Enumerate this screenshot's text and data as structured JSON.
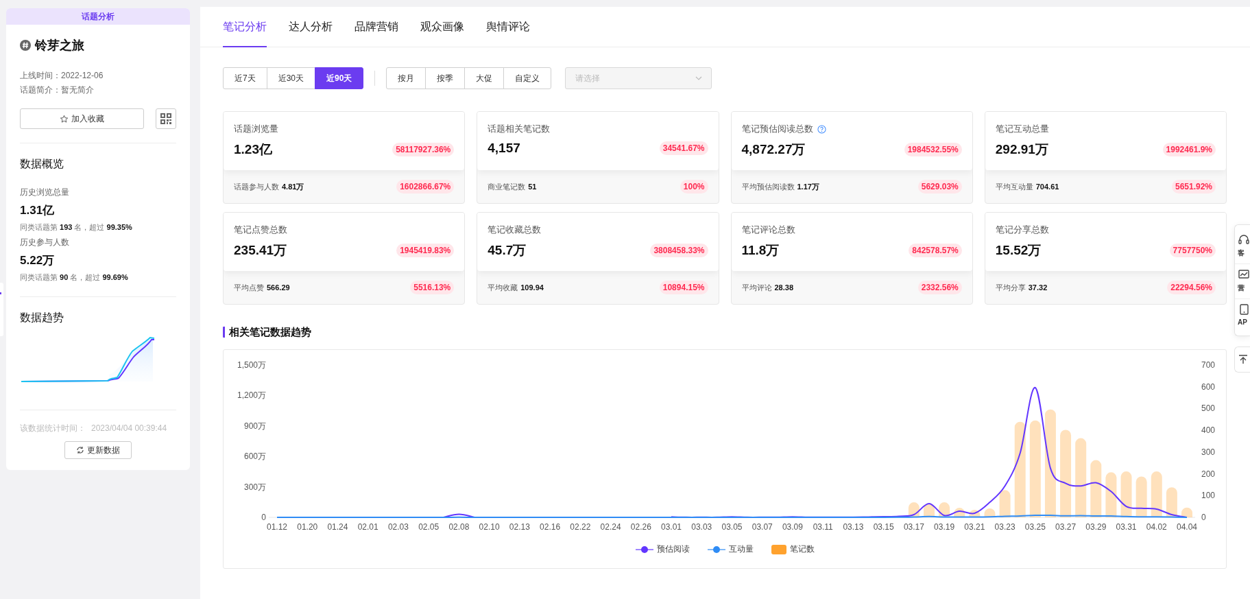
{
  "sidebar": {
    "header": "话题分析",
    "topic_title": "铃芽之旅",
    "info": [
      {
        "label": "上线时间：",
        "value": "2022-12-06"
      },
      {
        "label": "话题简介：",
        "value": "暂无简介"
      }
    ],
    "favorite_button": "加入收藏",
    "overview": {
      "title": "数据概览",
      "stats": [
        {
          "label": "历史浏览总量",
          "value": "1.31亿",
          "rank": "同类话题第 **193** 名，超过 **99.35%**"
        },
        {
          "label": "历史参与人数",
          "value": "5.22万",
          "rank": "同类话题第 **90** 名，超过 **99.69%**"
        }
      ]
    },
    "trend_title": "数据趋势",
    "updated": {
      "label": "该数据统计时间：",
      "value": "2023/04/04 00:39:44"
    },
    "refresh_button": "更新数据"
  },
  "tabs": [
    {
      "label": "笔记分析",
      "selected": true
    },
    {
      "label": "达人分析",
      "selected": false
    },
    {
      "label": "品牌营销",
      "selected": false
    },
    {
      "label": "观众画像",
      "selected": false
    },
    {
      "label": "舆情评论",
      "selected": false
    }
  ],
  "range_buttons": [
    {
      "label": "近7天",
      "selected": false
    },
    {
      "label": "近30天",
      "selected": false
    },
    {
      "label": "近90天",
      "selected": true
    }
  ],
  "period_buttons": [
    {
      "label": "按月",
      "selected": false
    },
    {
      "label": "按季",
      "selected": false
    },
    {
      "label": "大促",
      "selected": false
    },
    {
      "label": "自定义",
      "selected": false
    }
  ],
  "select": {
    "placeholder": "请选择",
    "disabled": true
  },
  "metrics": [
    {
      "title": "话题浏览量",
      "help": false,
      "value": "1.23亿",
      "change": "58117927.36%",
      "detail": {
        "label": "话题参与人数",
        "value": "4.81万",
        "change": "1602866.67%"
      }
    },
    {
      "title": "话题相关笔记数",
      "help": false,
      "value": "4,157",
      "change": "34541.67%",
      "detail": {
        "label": "商业笔记数",
        "value": "51",
        "change": "100%"
      }
    },
    {
      "title": "笔记预估阅读总数",
      "help": true,
      "value": "4,872.27万",
      "change": "1984532.55%",
      "detail": {
        "label": "平均预估阅读数",
        "value": "1.17万",
        "change": "5629.03%"
      }
    },
    {
      "title": "笔记互动总量",
      "help": false,
      "value": "292.91万",
      "change": "1992461.9%",
      "detail": {
        "label": "平均互动量",
        "value": "704.61",
        "change": "5651.92%"
      }
    },
    {
      "title": "笔记点赞总数",
      "help": false,
      "value": "235.41万",
      "change": "1945419.83%",
      "detail": {
        "label": "平均点赞",
        "value": "566.29",
        "change": "5516.13%"
      }
    },
    {
      "title": "笔记收藏总数",
      "help": false,
      "value": "45.7万",
      "change": "3808458.33%",
      "detail": {
        "label": "平均收藏",
        "value": "109.94",
        "change": "10894.15%"
      }
    },
    {
      "title": "笔记评论总数",
      "help": false,
      "value": "11.8万",
      "change": "842578.57%",
      "detail": {
        "label": "平均评论",
        "value": "28.38",
        "change": "2332.56%"
      }
    },
    {
      "title": "笔记分享总数",
      "help": false,
      "value": "15.52万",
      "change": "7757750%",
      "detail": {
        "label": "平均分享",
        "value": "37.32",
        "change": "22294.56%"
      }
    }
  ],
  "chart_section": {
    "title": "相关笔记数据趋势",
    "chart_data": {
      "type": "line",
      "ylim": [
        0,
        1500
      ],
      "y2lim": [
        0,
        700
      ],
      "legend": "bottom",
      "categories": [
        "01.12",
        null,
        "01.20",
        null,
        "01.24",
        null,
        "02.01",
        null,
        "02.03",
        null,
        "02.05",
        null,
        "02.08",
        null,
        "02.10",
        null,
        "02.13",
        null,
        "02.16",
        null,
        "02.22",
        null,
        "02.24",
        null,
        "02.26",
        null,
        "03.01",
        null,
        "03.03",
        null,
        "03.05",
        null,
        "03.07",
        null,
        "03.09",
        null,
        "03.11",
        null,
        "03.13",
        null,
        "03.15",
        null,
        "03.17",
        null,
        "03.19",
        null,
        "03.21",
        null,
        "03.23",
        null,
        "03.25",
        null,
        "03.27",
        null,
        "03.29",
        null,
        "03.31",
        null,
        "04.02",
        null,
        "04.04"
      ],
      "yticks": [
        {
          "value": 0,
          "label": "0"
        },
        {
          "value": 300,
          "label": "300万"
        },
        {
          "value": 600,
          "label": "600万"
        },
        {
          "value": 900,
          "label": "900万"
        },
        {
          "value": 1200,
          "label": "1,200万"
        },
        {
          "value": 1500,
          "label": "1,500万"
        }
      ],
      "y2ticks": [
        0,
        100,
        200,
        300,
        400,
        500,
        600,
        700
      ],
      "series": [
        {
          "name": "预估阅读",
          "color": "#6236ff",
          "values": [
            null,
            null,
            null,
            null,
            null,
            null,
            null,
            null,
            null,
            null,
            null,
            2,
            31,
            2,
            null,
            null,
            null,
            null,
            null,
            null,
            null,
            null,
            null,
            null,
            null,
            null,
            5,
            1,
            1,
            1,
            5,
            1,
            1,
            2,
            5,
            2,
            1,
            2,
            2,
            4,
            6,
            10,
            27,
            135,
            19,
            60,
            40,
            148,
            309,
            632,
            1277,
            484,
            336,
            309,
            341,
            255,
            108,
            89,
            81,
            27,
            0
          ]
        },
        {
          "name": "互动量",
          "color": "#2f8cf5",
          "values": [
            0,
            0,
            0,
            0,
            0,
            0,
            0,
            0,
            0,
            0,
            0,
            0,
            1,
            0,
            0,
            0,
            0,
            0,
            0,
            0,
            0,
            0,
            0,
            0,
            0,
            0,
            0,
            0,
            0,
            0,
            0,
            0,
            0,
            0,
            0,
            0,
            0,
            0,
            0,
            0,
            0,
            1,
            3,
            8,
            3,
            3,
            3,
            5,
            10,
            13,
            20,
            20,
            15,
            17,
            13,
            13,
            8,
            5,
            5,
            3,
            0
          ]
        },
        {
          "name": "笔记数",
          "type": "bar",
          "axis": "y2",
          "color": "#ffa22e",
          "values": [
            0,
            0,
            0,
            0,
            0,
            0,
            0,
            0,
            0,
            0,
            0,
            0,
            0,
            0,
            0,
            0,
            0,
            0,
            0,
            0,
            0,
            0,
            0,
            0,
            0,
            0,
            0,
            0,
            0,
            0,
            0,
            0,
            0,
            0,
            0,
            0,
            0,
            0,
            0,
            0,
            0,
            0,
            69,
            65,
            69,
            44,
            35,
            41,
            125,
            439,
            445,
            496,
            402,
            364,
            263,
            207,
            211,
            188,
            211,
            138,
            45
          ]
        }
      ]
    }
  },
  "side_tools": [
    {
      "label": "客",
      "kind": "headset"
    },
    {
      "label": "营",
      "kind": "chart"
    },
    {
      "label": "AP",
      "kind": "document"
    }
  ]
}
